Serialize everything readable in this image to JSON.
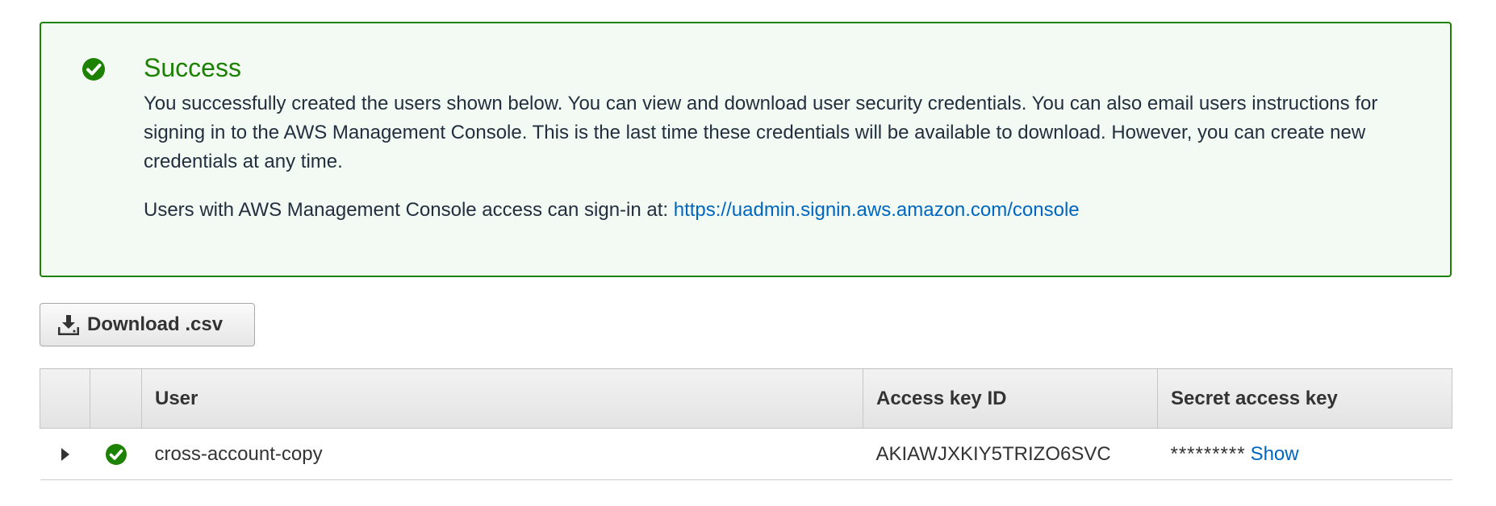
{
  "alert": {
    "title": "Success",
    "body": "You successfully created the users shown below. You can view and download user security credentials. You can also email users instructions for signing in to the AWS Management Console. This is the last time these credentials will be available to download. However, you can create new credentials at any time.",
    "signin_text": "Users with AWS Management Console access can sign-in at: ",
    "signin_url": "https://uadmin.signin.aws.amazon.com/console",
    "icon": "check-circle-icon",
    "color": "#1d8102"
  },
  "toolbar": {
    "download_label": "Download .csv",
    "download_icon": "download-icon"
  },
  "table": {
    "columns": [
      "",
      "",
      "User",
      "Access key ID",
      "Secret access key"
    ],
    "rows": [
      {
        "user": "cross-account-copy",
        "access_key_id": "AKIAWJXKIY5TRIZO6SVC",
        "secret_masked": "*********",
        "show_label": "Show",
        "status_icon": "check-circle-icon",
        "expand_icon": "caret-right-icon"
      }
    ]
  },
  "colors": {
    "success": "#1d8102",
    "link": "#0066c0"
  }
}
